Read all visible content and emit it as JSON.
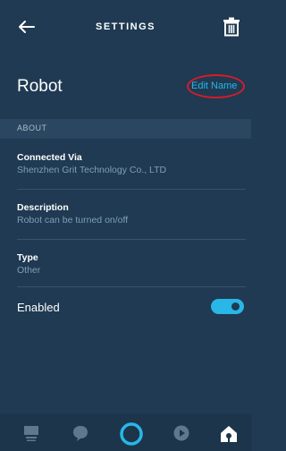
{
  "header": {
    "title": "SETTINGS",
    "back_icon": "back-arrow-icon",
    "trash_icon": "trash-icon"
  },
  "device": {
    "name": "Robot",
    "edit_label": "Edit Name"
  },
  "about": {
    "header": "ABOUT",
    "rows": [
      {
        "label": "Connected Via",
        "value": "Shenzhen Grit Technology Co., LTD"
      },
      {
        "label": "Description",
        "value": "Robot can be turned on/off"
      },
      {
        "label": "Type",
        "value": "Other"
      }
    ]
  },
  "enabled": {
    "label": "Enabled",
    "on": true
  },
  "nav": {
    "items": [
      {
        "icon": "home-list-icon"
      },
      {
        "icon": "chat-icon"
      },
      {
        "icon": "alexa-ring-icon"
      },
      {
        "icon": "play-icon"
      },
      {
        "icon": "devices-icon"
      }
    ]
  },
  "colors": {
    "background": "#1f3a52",
    "accent": "#29b6e8",
    "section": "#2a4660",
    "highlight": "#d61c2a"
  }
}
